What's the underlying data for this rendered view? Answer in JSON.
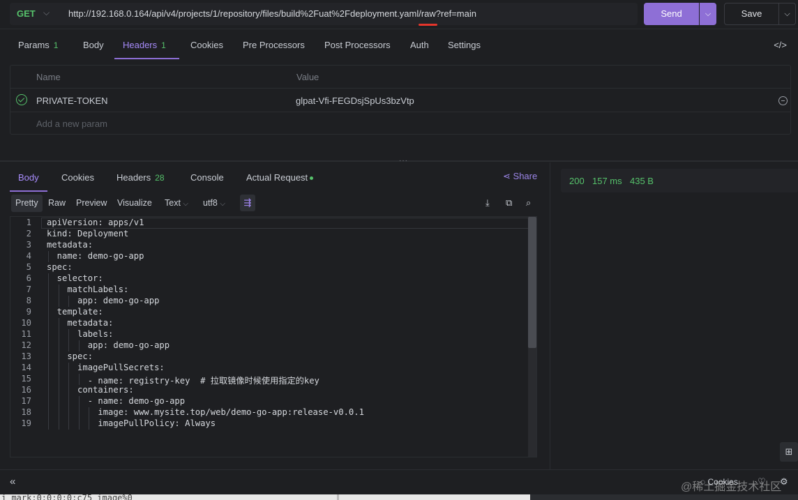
{
  "request": {
    "method": "GET",
    "url": "http://192.168.0.164/api/v4/projects/1/repository/files/build%2Fuat%2Fdeployment.yaml/raw?ref=main",
    "send_label": "Send",
    "save_label": "Save"
  },
  "req_tabs": [
    {
      "label": "Params",
      "count": "1"
    },
    {
      "label": "Body",
      "count": ""
    },
    {
      "label": "Headers",
      "count": "1"
    },
    {
      "label": "Cookies",
      "count": ""
    },
    {
      "label": "Pre Processors",
      "count": ""
    },
    {
      "label": "Post Processors",
      "count": ""
    },
    {
      "label": "Auth",
      "count": ""
    },
    {
      "label": "Settings",
      "count": ""
    }
  ],
  "headers_table": {
    "col_name": "Name",
    "col_value": "Value",
    "rows": [
      {
        "name": "PRIVATE-TOKEN",
        "value": "glpat-Vfi-FEGDsjSpUs3bzVtp"
      }
    ],
    "add_placeholder": "Add a new param"
  },
  "resp_tabs": [
    {
      "label": "Body",
      "count": ""
    },
    {
      "label": "Cookies",
      "count": ""
    },
    {
      "label": "Headers",
      "count": "28"
    },
    {
      "label": "Console",
      "count": ""
    },
    {
      "label": "Actual Request",
      "count": ""
    }
  ],
  "share_label": "Share",
  "status": {
    "code": "200",
    "time": "157 ms",
    "size": "435 B"
  },
  "view_options": {
    "modes": [
      "Pretty",
      "Raw",
      "Preview",
      "Visualize"
    ],
    "format": "Text",
    "encoding": "utf8"
  },
  "code_lines": [
    "apiVersion: apps/v1",
    "kind: Deployment",
    "metadata:",
    "  name: demo-go-app",
    "spec:",
    "  selector:",
    "    matchLabels:",
    "      app: demo-go-app",
    "  template:",
    "    metadata:",
    "      labels:",
    "        app: demo-go-app",
    "    spec:",
    "      imagePullSecrets:",
    "        - name: registry-key  # 拉取镜像时候使用指定的key",
    "      containers:",
    "        - name: demo-go-app",
    "          image: www.mysite.top/web/demo-go-app:release-v0.0.1",
    "          imagePullPolicy: Always"
  ],
  "bottom": {
    "cookies_label": "Cookies",
    "watermark": "@稀土掘金技术社区"
  },
  "terminal_text": "i mark:0:0:0:0:c75 image%0"
}
